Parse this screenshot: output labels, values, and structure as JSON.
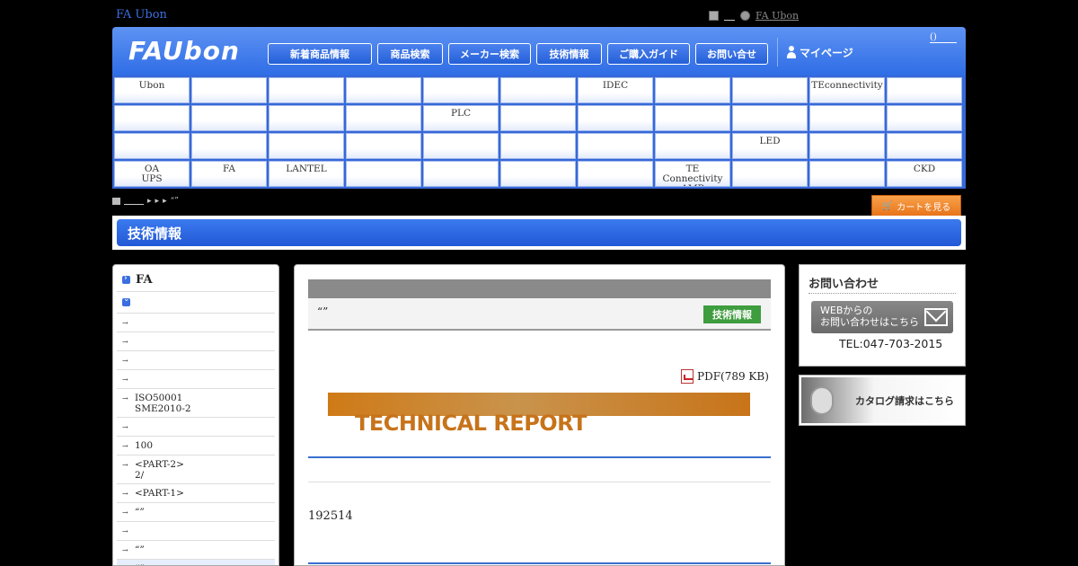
{
  "top": {
    "site_name": "FA Ubon",
    "right_link": "FA Ubon"
  },
  "header": {
    "logo": "FAUbon",
    "nav": [
      "新着商品情報",
      "商品検索",
      "メーカー検索",
      "技術情報",
      "ご購入ガイド",
      "お問い合せ"
    ],
    "mypage": "マイページ",
    "cart_count": "()"
  },
  "grid": [
    [
      "Ubon",
      "",
      "",
      "",
      "",
      "",
      "IDEC",
      "",
      "",
      "TEconnectivity",
      ""
    ],
    [
      "",
      "",
      "",
      "",
      "PLC",
      "",
      "",
      "",
      "",
      "",
      ""
    ],
    [
      "",
      "",
      "",
      "",
      "",
      "",
      "",
      "",
      "LED",
      "",
      ""
    ],
    [
      "OA\nUPS",
      "FA",
      "LANTEL",
      "",
      "",
      "",
      "",
      "TE\nConnectivity\nAMP",
      "",
      "",
      "CKD"
    ]
  ],
  "breadcrumb": {
    "tail": "“”"
  },
  "cart_button": "カートを見る",
  "page_title": "技術情報",
  "sidebar": {
    "heading": "FA",
    "items": [
      "",
      "",
      "",
      "",
      "ISO50001\nSME2010-2",
      "",
      "100",
      "<PART-2>\n2/",
      "<PART-1>",
      "“”",
      "",
      "“”",
      "“”"
    ]
  },
  "article": {
    "title": "“”",
    "badge": "技術情報",
    "pdf": "PDF(789 KB)",
    "banner": "TECHNICAL REPORT",
    "body": "192514"
  },
  "right": {
    "contact_title": "お問い合わせ",
    "web_button_line1": "WEBからの",
    "web_button_line2": "お問い合わせはこちら",
    "tel": "TEL:047-703-2015",
    "catalog": "カタログ請求はこちら"
  }
}
